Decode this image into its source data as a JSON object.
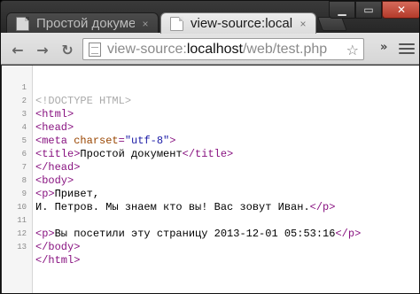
{
  "tabs": [
    {
      "title": "Простой докумен",
      "active": false,
      "close": "×"
    },
    {
      "title": "view-source:localh",
      "active": true,
      "close": "×"
    }
  ],
  "window_controls": {
    "minimize": "▁",
    "maximize": "▭",
    "close": "✕"
  },
  "toolbar": {
    "back": "←",
    "forward": "→",
    "reload": "↻",
    "url_scheme": "view-source:",
    "url_host": "localhost",
    "url_path": "/web/test.php",
    "star": "☆",
    "more": "»"
  },
  "source_lines": [
    {
      "n": "1",
      "doctype": "<!DOCTYPE HTML>"
    },
    {
      "n": "2",
      "open": "<html>"
    },
    {
      "n": "3",
      "open": "<head>"
    },
    {
      "n": "4",
      "open": "<meta ",
      "attr": "charset",
      "eq": "=",
      "val": "\"utf-8\"",
      "close_bracket": ">"
    },
    {
      "n": "5",
      "open": "<title>",
      "text": "Простой документ",
      "close": "</title>"
    },
    {
      "n": "6",
      "open": "</head>"
    },
    {
      "n": "7",
      "open": "<body>"
    },
    {
      "n": "8",
      "open": "<p>",
      "text": "Привет,"
    },
    {
      "n": "9",
      "text": "И. Петров. Мы знаем кто вы! Вас зовут Иван.",
      "close": "</p>"
    },
    {
      "n": "10"
    },
    {
      "n": "11",
      "open": "<p>",
      "text": "Вы посетили эту страницу 2013-12-01 05:53:16",
      "close": "</p>"
    },
    {
      "n": "12",
      "open": "</body>"
    },
    {
      "n": "13",
      "open": "</html>"
    }
  ]
}
